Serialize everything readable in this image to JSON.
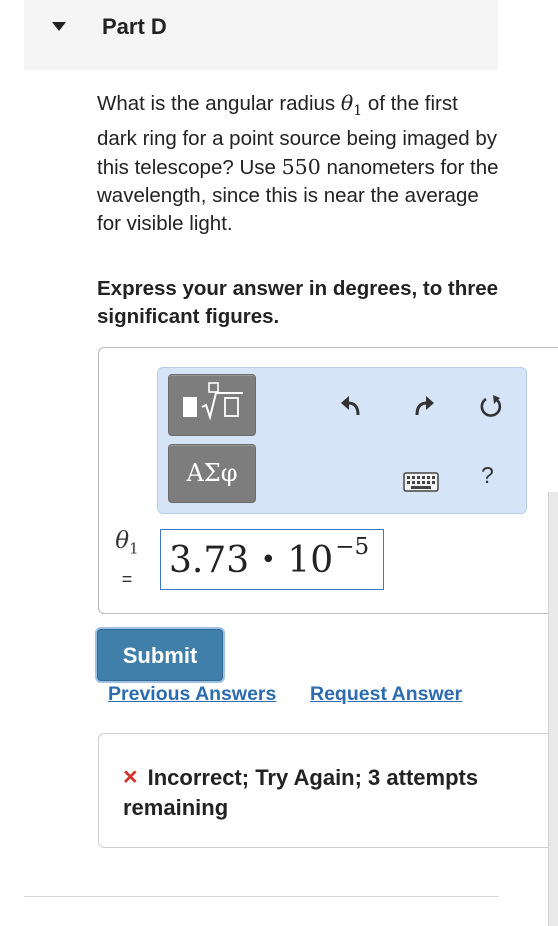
{
  "header": {
    "part_title": "Part D"
  },
  "question": {
    "text_before": "What is the angular radius ",
    "symbol": "θ",
    "subscript": "1",
    "text_middle": " of the first dark ring for a point source being imaged by this telescope? Use ",
    "number": "550",
    "text_after": " nanometers for the wavelength, since this is near the average for visible light."
  },
  "instruction": "Express your answer in degrees, to three significant figures.",
  "toolbar": {
    "greek_label": "ΑΣφ",
    "help_label": "?",
    "icons": [
      "template-icon",
      "sqrt-icon",
      "undo-icon",
      "redo-icon",
      "reset-icon",
      "keyboard-icon",
      "help-icon"
    ]
  },
  "answer": {
    "label_symbol": "θ",
    "label_subscript": "1",
    "label_equals": "=",
    "mantissa": "3.73",
    "operator": "•",
    "base": "10",
    "exponent": "−5"
  },
  "actions": {
    "submit_label": "Submit",
    "previous_answers_label": "Previous Answers",
    "request_answer_label": "Request Answer"
  },
  "feedback": {
    "icon": "×",
    "line1": "Incorrect; Try Again; 3 attempts",
    "line2": "remaining",
    "color": "#d0342c"
  },
  "colors": {
    "accent": "#3f7fa9",
    "link": "#2d6bb0",
    "toolbar_bg": "#d6e4f8"
  }
}
